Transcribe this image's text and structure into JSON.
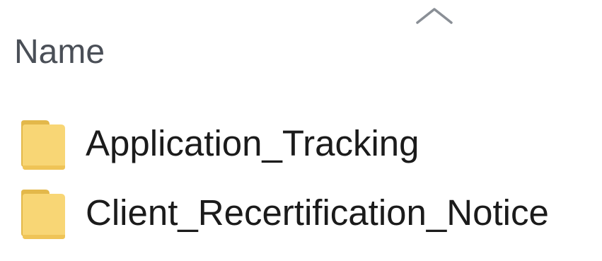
{
  "file_explorer": {
    "column_header": {
      "name_label": "Name",
      "sort_icon": "chevron-up-icon",
      "sort_direction": "ascending"
    },
    "items": [
      {
        "name": "Application_Tracking",
        "icon": "folder-icon"
      },
      {
        "name": "Client_Recertification_Notice",
        "icon": "folder-icon"
      }
    ],
    "colors": {
      "folder_fill": "#f8d675",
      "folder_edge": "#e3b84a",
      "header_text": "#4a4f57",
      "item_text": "#1b1b1b"
    }
  }
}
